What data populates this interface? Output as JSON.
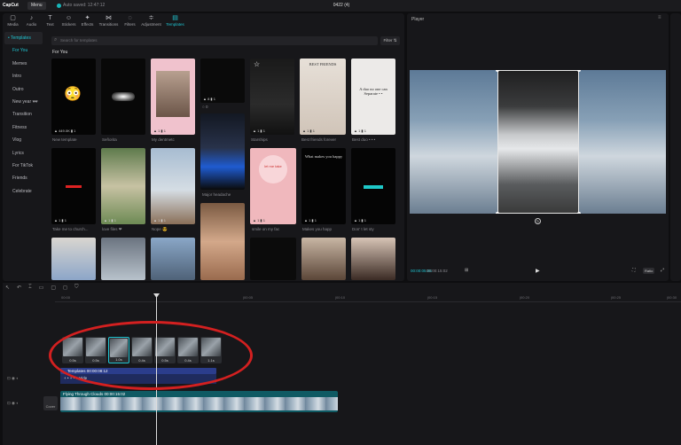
{
  "titlebar": {
    "app": "CapCut",
    "menu": "Menu",
    "autosave": "Auto saved: 12:47:12",
    "doc_title": "0422 (4)"
  },
  "toolbar": [
    {
      "icon": "▢",
      "label": "Media"
    },
    {
      "icon": "♪",
      "label": "Audio"
    },
    {
      "icon": "T",
      "label": "Text"
    },
    {
      "icon": "☺",
      "label": "Stickers"
    },
    {
      "icon": "✦",
      "label": "Effects"
    },
    {
      "icon": "⋈",
      "label": "Transitions"
    },
    {
      "icon": "◌",
      "label": "Filters"
    },
    {
      "icon": "≑",
      "label": "Adjustment"
    },
    {
      "icon": "▤",
      "label": "Templates"
    }
  ],
  "categories": [
    "• Templates",
    "For You",
    "Memes",
    "Intro",
    "Outro",
    "New year 🕶",
    "Transition",
    "Fitness",
    "Vlog",
    "Lyrics",
    "For TikTok",
    "Friends",
    "Celebrate"
  ],
  "search": {
    "placeholder": "Search for templates",
    "filter": "Filter ⇅"
  },
  "section": "For You",
  "templates": {
    "row1": [
      {
        "caption": "New template",
        "stats": "▲ 449.0K  ▮ 1"
      },
      {
        "caption": "Señorita",
        "stats": ""
      },
      {
        "caption": "My dentmetc",
        "stats": "▲ 1  ▮ 1"
      },
      {
        "caption": "○ 0",
        "stats": "▲ 8  ▮ 1"
      },
      {
        "caption": "Starships",
        "stats": "▲ 1  ▮ 1"
      },
      {
        "caption": "Best friends forever",
        "stats": "▲ 1  ▮ 1"
      },
      {
        "caption": "Best duo • • •",
        "stats": "▲ 1  ▮ 1"
      }
    ],
    "row2": [
      {
        "caption": "Take me to church...",
        "stats": "▲ 1  ▮ 1"
      },
      {
        "caption": "love files ❤",
        "stats": "▲ 1  ▮ 1"
      },
      {
        "caption": "Nope 😎",
        "stats": "▲ 1  ▮ 1"
      },
      {
        "caption": "Major headache",
        "stats": ""
      },
      {
        "caption": "smile on my fac",
        "stats": "▲ 1  ▮ 1"
      },
      {
        "caption": "Makes you happ",
        "stats": "▲ 1  ▮ 1"
      },
      {
        "caption": "Don' t let sty",
        "stats": "▲ 1  ▮ 1"
      }
    ]
  },
  "thumb_text": {
    "best_friends": "BEST FRIENDS",
    "duo": "A duo no one can Separate • •",
    "smile": "let me take",
    "happy": "What makes you happy"
  },
  "player": {
    "title": "Player",
    "current": "00:00:05:06",
    "total": "00:00:15:02",
    "ratio": "Ratio"
  },
  "timeline": {
    "ticks": [
      "00:00",
      "|00:05",
      "|00:10",
      "|00:15",
      "|00:20",
      "|00:25",
      "|00:30"
    ],
    "clips": [
      "0.5s",
      "0.5s",
      "1.0s",
      "0.4s",
      "0.5s",
      "0.4s",
      "1.1s"
    ],
    "template_track": "Templates  00:00:08:12",
    "template_sub": "+  •  +  •  ▾  Hide",
    "main_track": "Flying Through Clouds  00:00:15:02",
    "cover": "Cover"
  }
}
